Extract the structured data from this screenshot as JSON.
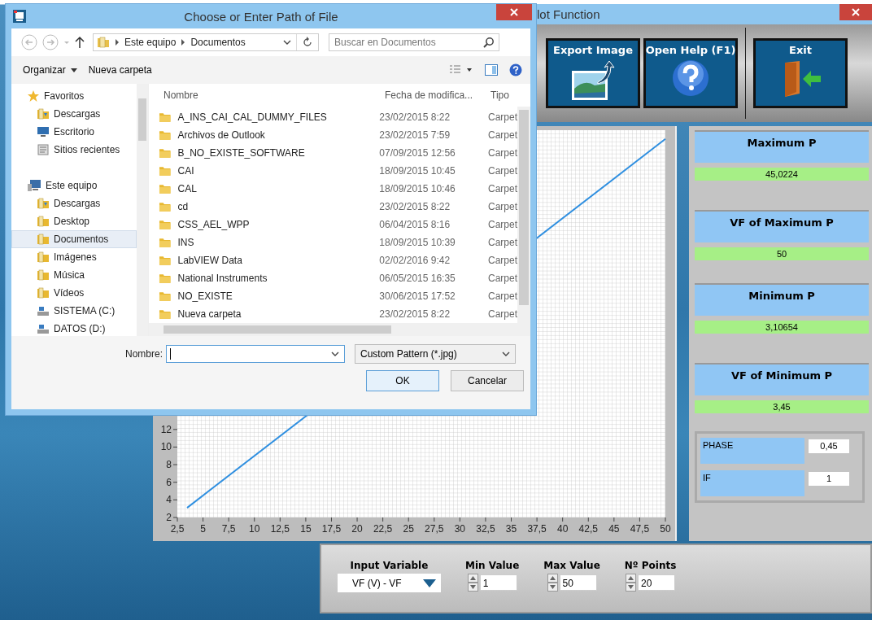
{
  "main": {
    "title": "lot Function",
    "buttons": [
      {
        "label": "Export Image",
        "kind": "export"
      },
      {
        "label": "Open Help (F1)",
        "kind": "help"
      },
      {
        "label": "Exit",
        "kind": "exit"
      }
    ],
    "chart": {
      "chart_data": {
        "type": "line",
        "x": [
          3.45,
          50
        ],
        "series": [
          {
            "color": "#2f8fe0",
            "values": [
              3.1,
              45
            ]
          }
        ],
        "xlim": [
          2.5,
          50
        ],
        "ylim": [
          2,
          46
        ],
        "xticks": [
          {
            "value": 2.5,
            "label": "2,5"
          },
          {
            "value": 5,
            "label": "5"
          },
          {
            "value": 7.5,
            "label": "7,5"
          },
          {
            "value": 10,
            "label": "10"
          },
          {
            "value": 12.5,
            "label": "12,5"
          },
          {
            "value": 15,
            "label": "15"
          },
          {
            "value": 17.5,
            "label": "17,5"
          },
          {
            "value": 20,
            "label": "20"
          },
          {
            "value": 22.5,
            "label": "22,5"
          },
          {
            "value": 25,
            "label": "25"
          },
          {
            "value": 27.5,
            "label": "27,5"
          },
          {
            "value": 30,
            "label": "30"
          },
          {
            "value": 32.5,
            "label": "32,5"
          },
          {
            "value": 35,
            "label": "35"
          },
          {
            "value": 37.5,
            "label": "37,5"
          },
          {
            "value": 40,
            "label": "40"
          },
          {
            "value": 42.5,
            "label": "42,5"
          },
          {
            "value": 45,
            "label": "45"
          },
          {
            "value": 47.5,
            "label": "47,5"
          },
          {
            "value": 50,
            "label": "50"
          }
        ],
        "yticks": [
          2,
          4,
          6,
          8,
          10,
          12
        ]
      }
    },
    "results": [
      {
        "label": "Maximum P",
        "value": "45,0224"
      },
      {
        "label": "VF of Maximum P",
        "value": "50"
      },
      {
        "label": "Minimum P",
        "value": "3,10654"
      },
      {
        "label": "VF of Minimum P",
        "value": "3,45"
      }
    ],
    "params": [
      {
        "label": "PHASE",
        "value": "0,45"
      },
      {
        "label": "IF",
        "value": "1"
      }
    ],
    "controls": {
      "input_variable": {
        "label": "Input Variable",
        "value": "VF (V) - VF"
      },
      "spinners": [
        {
          "label": "Min Value",
          "value": "1"
        },
        {
          "label": "Max Value",
          "value": "50"
        },
        {
          "label": "Nº Points",
          "value": "20"
        }
      ]
    }
  },
  "dialog": {
    "title": "Choose or Enter Path of File",
    "breadcrumb": [
      "Este equipo",
      "Documentos"
    ],
    "search": {
      "placeholder": "Buscar en Documentos"
    },
    "toolbar": [
      "Organizar",
      "Nueva carpeta"
    ],
    "sidebar": [
      {
        "label": "Favoritos",
        "kind": "star",
        "selected": false,
        "children": [
          {
            "label": "Descargas",
            "kind": "downloads",
            "selected": false
          },
          {
            "label": "Escritorio",
            "kind": "desktop",
            "selected": false
          },
          {
            "label": "Sitios recientes",
            "kind": "recent",
            "selected": false
          }
        ]
      },
      {
        "label": "Este equipo",
        "kind": "computer",
        "selected": false,
        "children": [
          {
            "label": "Descargas",
            "kind": "downloads",
            "selected": false
          },
          {
            "label": "Desktop",
            "kind": "folder",
            "selected": false
          },
          {
            "label": "Documentos",
            "kind": "folder",
            "selected": true
          },
          {
            "label": "Imágenes",
            "kind": "folder",
            "selected": false
          },
          {
            "label": "Música",
            "kind": "folder",
            "selected": false
          },
          {
            "label": "Vídeos",
            "kind": "folder",
            "selected": false
          },
          {
            "label": "SISTEMA (C:)",
            "kind": "drive",
            "selected": false
          },
          {
            "label": "DATOS (D:)",
            "kind": "drive",
            "selected": false
          }
        ]
      }
    ],
    "columns": [
      "Nombre",
      "Fecha de modifica...",
      "Tipo"
    ],
    "files": [
      {
        "name": "A_INS_CAI_CAL_DUMMY_FILES",
        "date": "23/02/2015 8:22",
        "type": "Carpet"
      },
      {
        "name": "Archivos de Outlook",
        "date": "23/02/2015 7:59",
        "type": "Carpet"
      },
      {
        "name": "B_NO_EXISTE_SOFTWARE",
        "date": "07/09/2015 12:56",
        "type": "Carpet"
      },
      {
        "name": "CAI",
        "date": "18/09/2015 10:45",
        "type": "Carpet"
      },
      {
        "name": "CAL",
        "date": "18/09/2015 10:46",
        "type": "Carpet"
      },
      {
        "name": "cd",
        "date": "23/02/2015 8:22",
        "type": "Carpet"
      },
      {
        "name": "CSS_AEL_WPP",
        "date": "06/04/2015 8:16",
        "type": "Carpet"
      },
      {
        "name": "INS",
        "date": "18/09/2015 10:39",
        "type": "Carpet"
      },
      {
        "name": "LabVIEW Data",
        "date": "02/02/2016 9:42",
        "type": "Carpet"
      },
      {
        "name": "National Instruments",
        "date": "06/05/2015 16:35",
        "type": "Carpet"
      },
      {
        "name": "NO_EXISTE",
        "date": "30/06/2015 17:52",
        "type": "Carpet"
      },
      {
        "name": "Nueva carpeta",
        "date": "23/02/2015 8:22",
        "type": "Carpet"
      }
    ],
    "filename": {
      "label": "Nombre:"
    },
    "filter": "Custom Pattern (*.jpg)",
    "buttons": [
      "OK",
      "Cancelar"
    ]
  }
}
